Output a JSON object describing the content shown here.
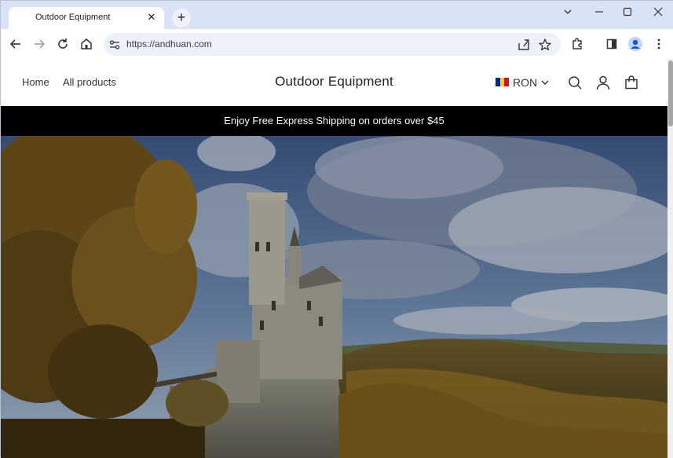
{
  "browser": {
    "tab_title": "Outdoor Equipment",
    "url": "https://andhuan.com"
  },
  "site": {
    "nav": [
      "Home",
      "All products"
    ],
    "brand": "Outdoor Equipment",
    "currency": "RON",
    "announcement": "Enjoy Free Express Shipping on orders over $45"
  },
  "colors": {
    "announcement_bg": "#000000",
    "flag": [
      "#002b7f",
      "#fcd116",
      "#ce1126"
    ]
  },
  "icons": [
    "back-icon",
    "forward-icon",
    "reload-icon",
    "home-icon",
    "site-info-icon",
    "share-icon",
    "star-icon",
    "extensions-icon",
    "sidepanel-icon",
    "profile-icon",
    "more-icon",
    "search-icon",
    "account-icon",
    "cart-icon"
  ]
}
